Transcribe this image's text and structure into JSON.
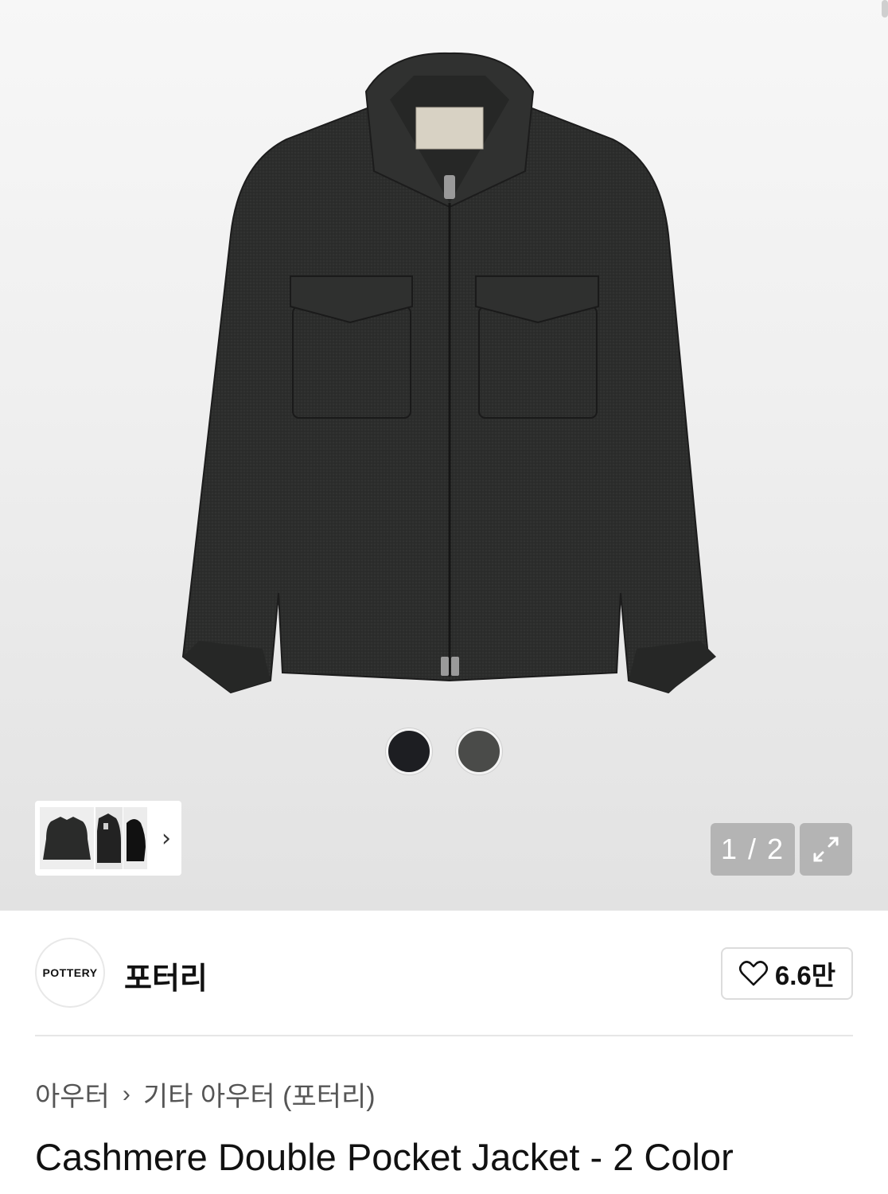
{
  "gallery": {
    "counter": "1 / 2",
    "swatches": [
      {
        "name": "navy-black",
        "color": "#1d1e22"
      },
      {
        "name": "charcoal",
        "color": "#4a4b49"
      }
    ],
    "thumbnails_next": "›",
    "expand_icon": "expand-icon"
  },
  "brand": {
    "logo_text": "POTTERY",
    "name": "포터리"
  },
  "like": {
    "count": "6.6만",
    "icon": "heart-icon"
  },
  "breadcrumb": {
    "level1": "아우터",
    "separator": "›",
    "level2": "기타 아우터 (포터리)"
  },
  "product": {
    "title": "Cashmere Double Pocket Jacket - 2 Color"
  },
  "colors": {
    "jacket": "#2b2c2b",
    "counter_bg": "#b4b4b4"
  }
}
